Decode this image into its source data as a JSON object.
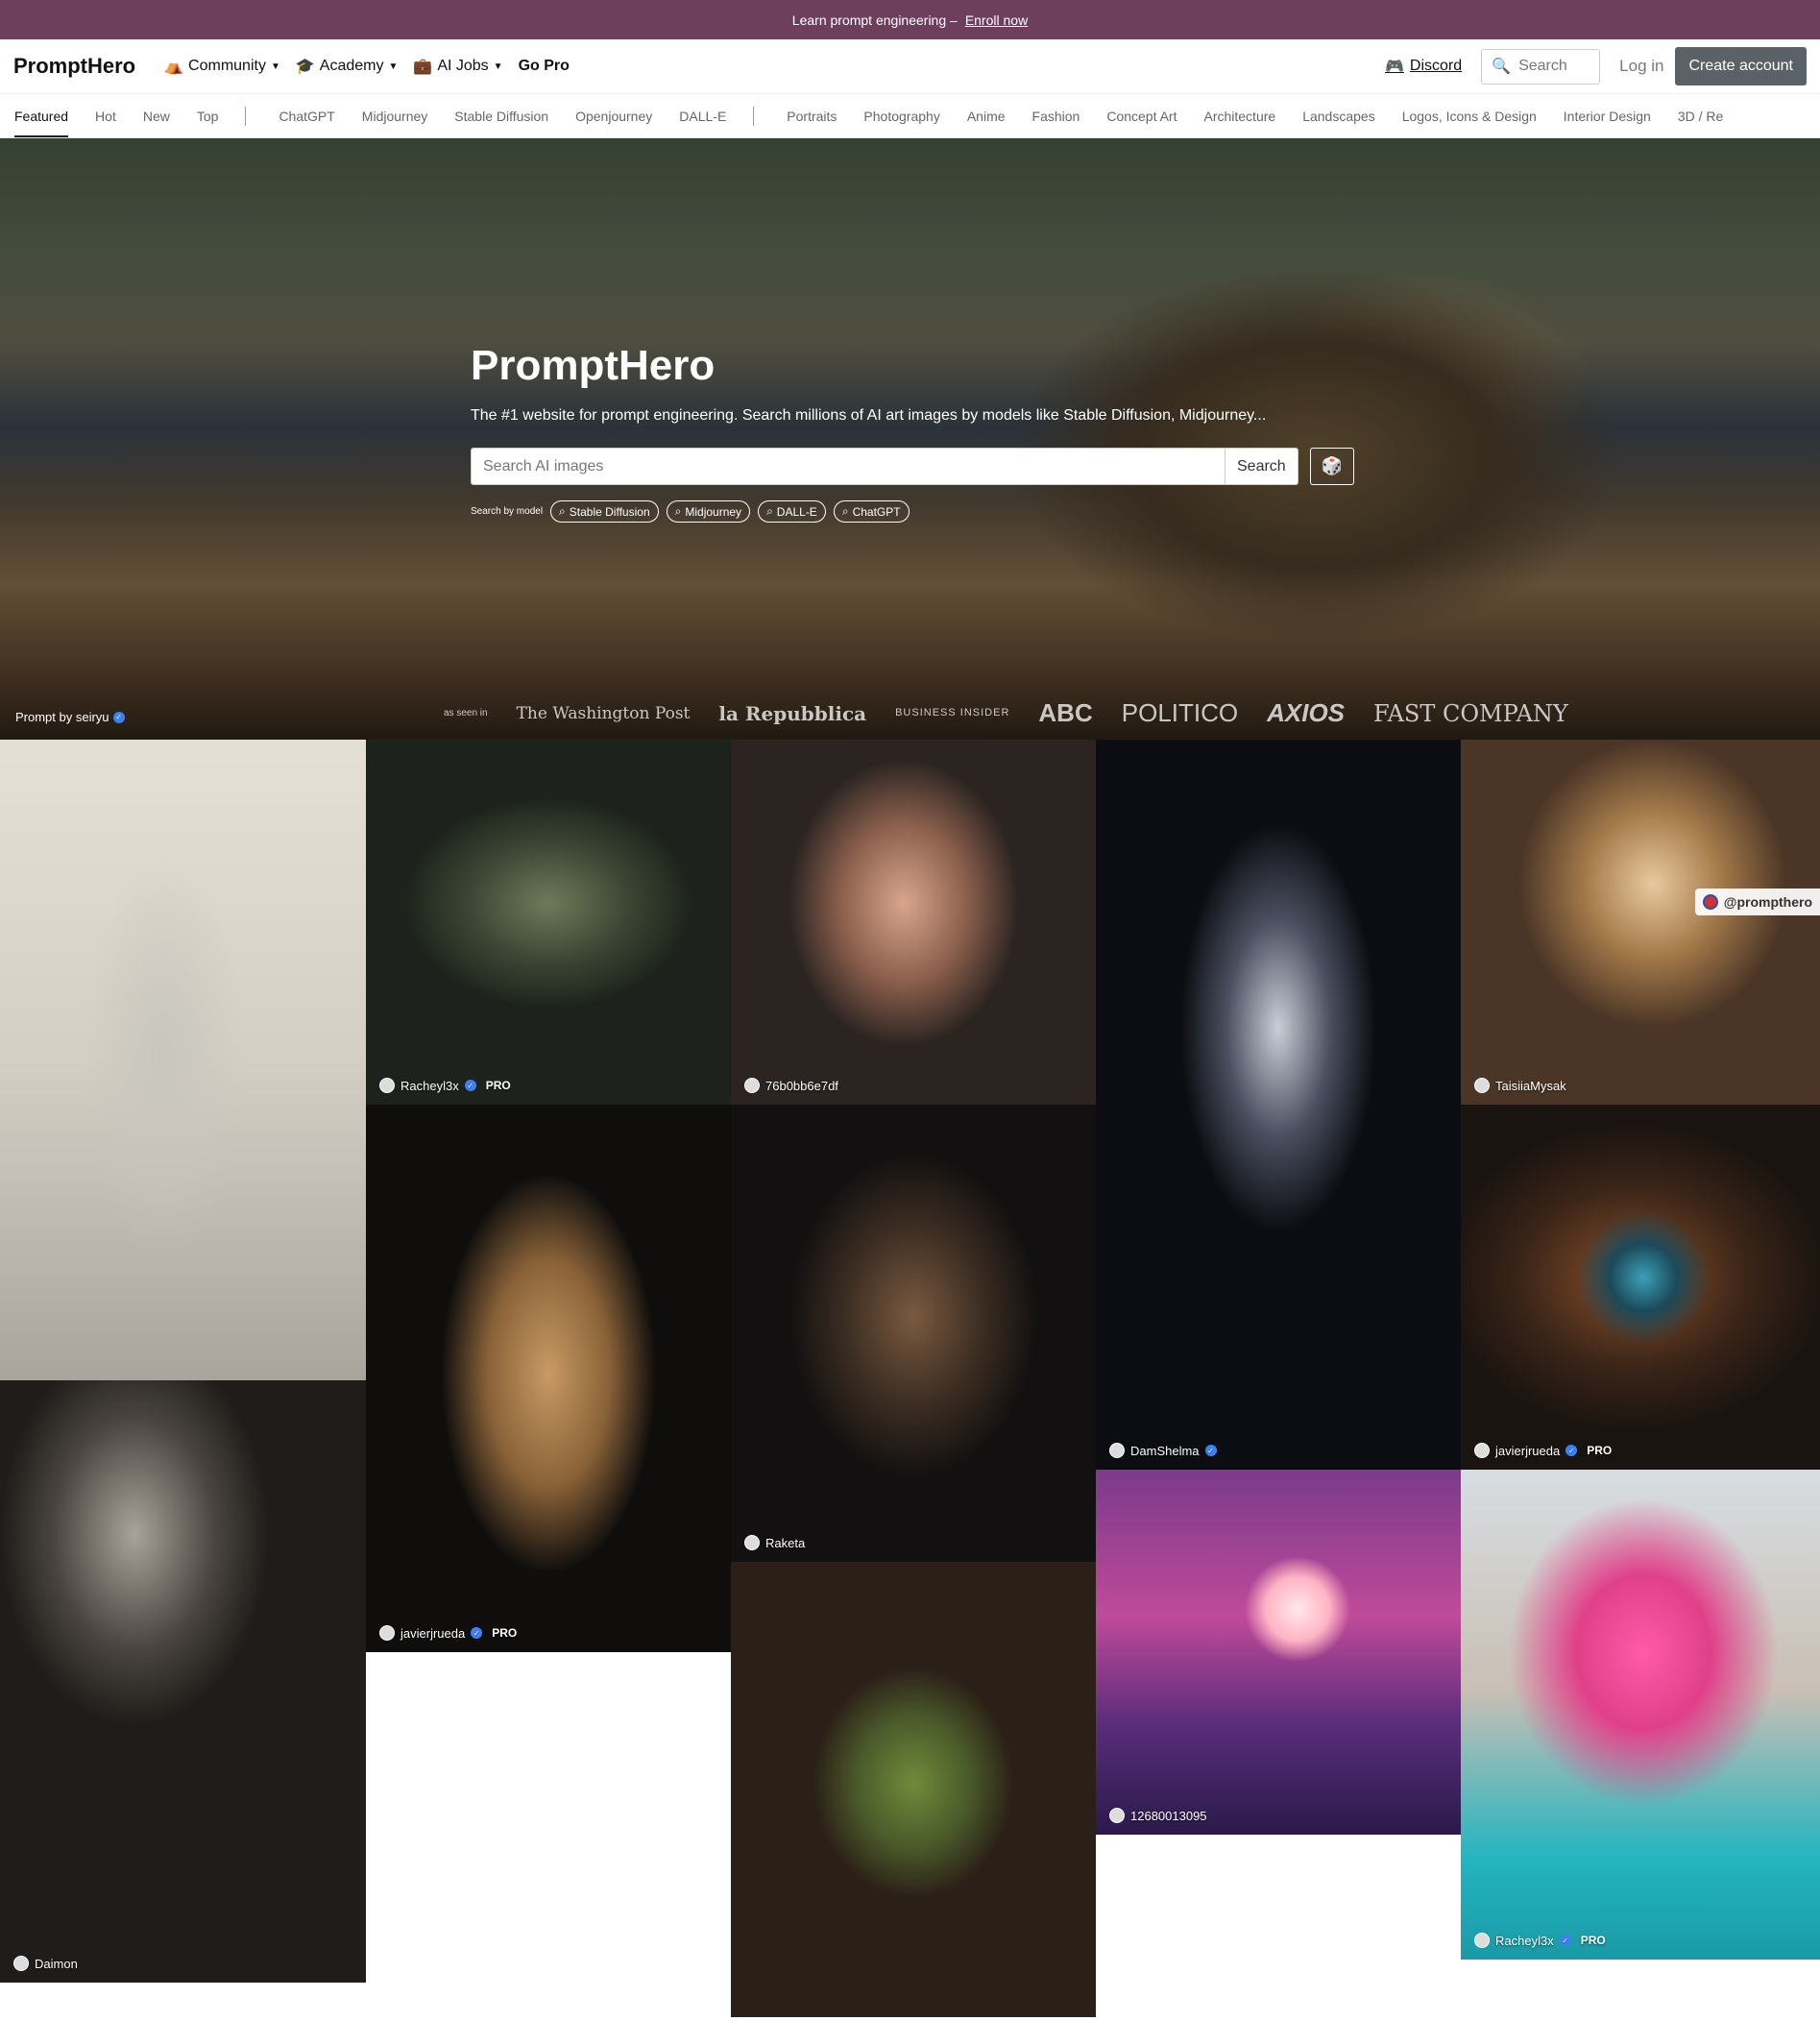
{
  "promo": {
    "text": "Learn prompt engineering –",
    "link": "Enroll now"
  },
  "nav": {
    "logo": "PromptHero",
    "community": "Community",
    "academy": "Academy",
    "ai_jobs": "AI Jobs",
    "go_pro": "Go Pro",
    "discord": "Discord",
    "search_placeholder": "Search",
    "login": "Log in",
    "create_account": "Create account"
  },
  "tabs": [
    "Featured",
    "Hot",
    "New",
    "Top",
    "ChatGPT",
    "Midjourney",
    "Stable Diffusion",
    "Openjourney",
    "DALL-E",
    "Portraits",
    "Photography",
    "Anime",
    "Fashion",
    "Concept Art",
    "Architecture",
    "Landscapes",
    "Logos, Icons & Design",
    "Interior Design",
    "3D / Re"
  ],
  "hero": {
    "title": "PromptHero",
    "subtitle": "The #1 website for prompt engineering. Search millions of AI art images by models like Stable Diffusion, Midjourney...",
    "search_placeholder": "Search AI images",
    "search_button": "Search",
    "search_by_model": "Search by model",
    "models": [
      "Stable Diffusion",
      "Midjourney",
      "DALL-E",
      "ChatGPT"
    ],
    "prompt_by": "Prompt by seiryu",
    "as_seen_in": "as seen in",
    "press": [
      "The Washington Post",
      "la Repubblica",
      "BUSINESS INSIDER",
      "ABC",
      "POLITICO",
      "AXIOS",
      "FAST COMPANY"
    ]
  },
  "cards": [
    {
      "user": "Racheyl3x",
      "pro": "PRO"
    },
    {
      "user": "76b0bb6e7df",
      "pro": ""
    },
    {
      "user": "TaisiiaMysak",
      "pro": ""
    },
    {
      "user": "javierjrueda",
      "pro": "PRO"
    },
    {
      "user": "Raketa",
      "pro": ""
    },
    {
      "user": "DamShelma",
      "pro": ""
    },
    {
      "user": "javierjrueda",
      "pro": "PRO"
    },
    {
      "user": "Daimon",
      "pro": ""
    },
    {
      "user": "12680013095",
      "pro": ""
    },
    {
      "user": "Racheyl3x",
      "pro": "PRO"
    }
  ],
  "tag_pill": "@prompthero",
  "colors": {
    "promo_bg": "#6e3f5c",
    "create_bg": "#5a6268",
    "verified": "#3b82f6"
  }
}
